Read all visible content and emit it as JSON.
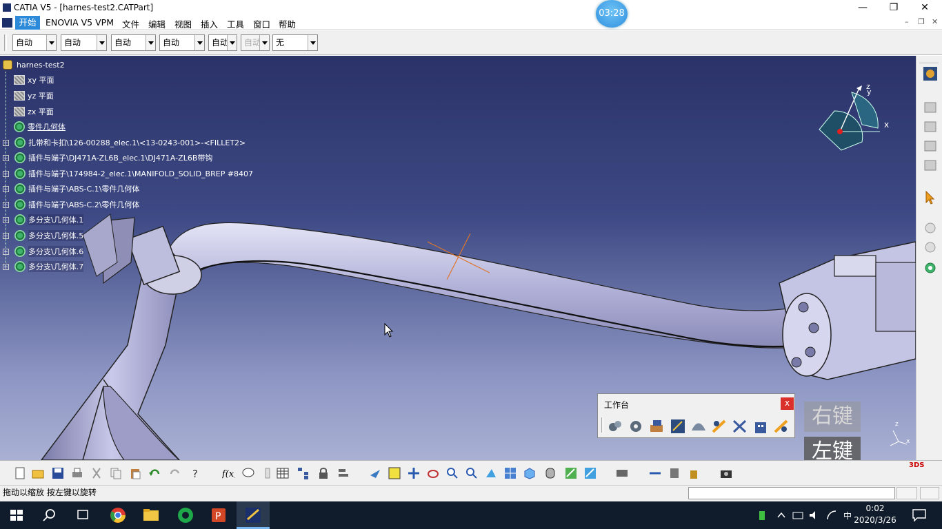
{
  "window": {
    "title": "CATIA V5 - [harnes-test2.CATPart]",
    "minimize": "—",
    "maximize": "❐",
    "close": "✕"
  },
  "timer": "03:28",
  "menu": {
    "start": "开始",
    "items": [
      "ENOVIA V5 VPM",
      "文件",
      "编辑",
      "视图",
      "插入",
      "工具",
      "窗口",
      "帮助"
    ],
    "mdi": [
      "–",
      "❐",
      "✕"
    ]
  },
  "toolbar_top": {
    "combos": [
      "自动",
      "自动",
      "自动",
      "自动",
      "自动",
      "自动",
      "无"
    ]
  },
  "tree": {
    "root": "harnes-test2",
    "items": [
      {
        "label": "xy 平面",
        "type": "plane"
      },
      {
        "label": "yz 平面",
        "type": "plane"
      },
      {
        "label": "zx 平面",
        "type": "plane"
      },
      {
        "label": "零件几何体",
        "type": "body"
      },
      {
        "label": "扎带和卡扣\\126-00288_elec.1\\<13-0243-001>-<FILLET2>",
        "type": "body"
      },
      {
        "label": "插件与端子\\DJ471A-ZL6B_elec.1\\DJ471A-ZL6B带钩",
        "type": "body"
      },
      {
        "label": "插件与端子\\174984-2_elec.1\\MANIFOLD_SOLID_BREP #8407",
        "type": "body"
      },
      {
        "label": "插件与端子\\ABS-C.1\\零件几何体",
        "type": "body"
      },
      {
        "label": "插件与端子\\ABS-C.2\\零件几何体",
        "type": "body"
      },
      {
        "label": "多分支\\几何体.1",
        "type": "body"
      },
      {
        "label": "多分支\\几何体.5",
        "type": "body"
      },
      {
        "label": "多分支\\几何体.6",
        "type": "body"
      },
      {
        "label": "多分支\\几何体.7",
        "type": "body"
      }
    ]
  },
  "compass": {
    "x": "x",
    "y": "y",
    "z": "z"
  },
  "workbench": {
    "title": "工作台",
    "close": "x"
  },
  "keys": [
    "右键",
    "左键",
    "右键"
  ],
  "status": "拖动以缩放  按左键以旋转",
  "clock": {
    "time": "0:02",
    "date": "2020/3/26"
  },
  "ime": "中",
  "colors": {
    "accent": "#2d8ad8",
    "viewport_top": "#2a3268",
    "viewport_bottom": "#a9b0d3"
  }
}
